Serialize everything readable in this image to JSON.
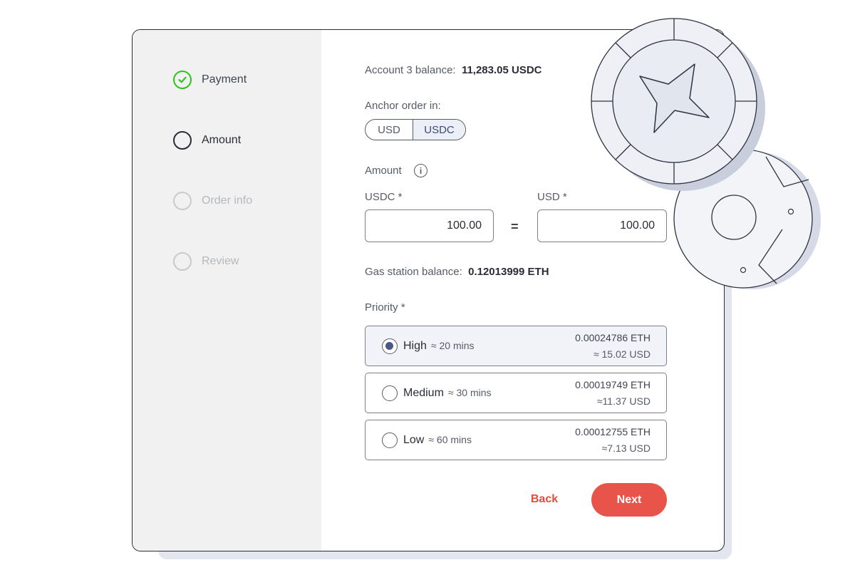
{
  "steps": [
    {
      "label": "Payment",
      "state": "done"
    },
    {
      "label": "Amount",
      "state": "active"
    },
    {
      "label": "Order info",
      "state": "future"
    },
    {
      "label": "Review",
      "state": "future"
    }
  ],
  "balance": {
    "label": "Account 3 balance:",
    "value": "11,283.05 USDC"
  },
  "anchor": {
    "label": "Anchor order in:",
    "options": [
      "USD",
      "USDC"
    ],
    "selected": "USDC"
  },
  "amount": {
    "label": "Amount",
    "info_icon": "info-icon",
    "usdc_label": "USDC *",
    "usdc_value": "100.00",
    "equals": "=",
    "usd_label": "USD *",
    "usd_value": "100.00"
  },
  "gas": {
    "label": "Gas station balance:",
    "value": "0.12013999 ETH"
  },
  "priority": {
    "label": "Priority *",
    "options": [
      {
        "name": "High",
        "time": "≈ 20 mins",
        "eth": "0.00024786 ETH",
        "usd": "≈ 15.02 USD",
        "selected": true
      },
      {
        "name": "Medium",
        "time": "≈ 30 mins",
        "eth": "0.00019749 ETH",
        "usd": "≈11.37 USD",
        "selected": false
      },
      {
        "name": "Low",
        "time": "≈ 60 mins",
        "eth": "0.00012755 ETH",
        "usd": "≈7.13 USD",
        "selected": false
      }
    ]
  },
  "actions": {
    "back": "Back",
    "next": "Next"
  },
  "colors": {
    "accent": "#e8544a",
    "success": "#2ec11f",
    "selected_radio": "#4a5786"
  }
}
